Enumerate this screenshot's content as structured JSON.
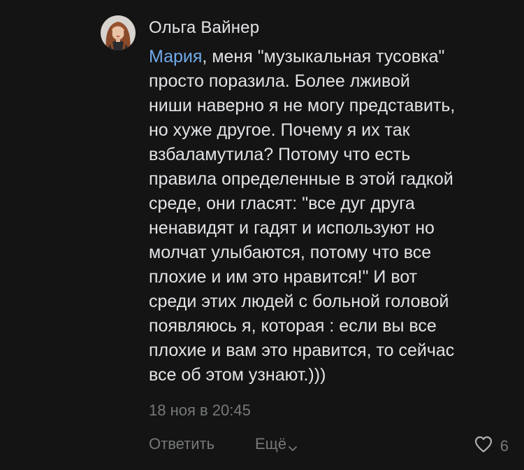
{
  "comment": {
    "author": "Ольга Вайнер",
    "mention": "Мария",
    "text": ", меня \"музыкальная тусовка\"\nпросто поразила. Более лживой\nниши наверно я не могу представить,\nно хуже другое. Почему я их так\nвзбаламутила? Потому что есть\nправила определенные в этой гадкой\nсреде, они гласят: \"все дуг друга\nненавидят и гадят и используют но\nмолчат улыбаются, потому что все\nплохие и им это нравится!\" И вот\nсреди этих людей с больной головой\nпоявляюсь я, которая : если вы все\nплохие и вам это нравится, то сейчас\nвсе об этом узнают.)))",
    "timestamp": "18 ноя в 20:45",
    "reply_label": "Ответить",
    "more_label": "Ещё",
    "likes": "6"
  },
  "icons": {
    "more": "chevron-down-icon",
    "like": "heart-icon"
  },
  "colors": {
    "background": "#141414",
    "text": "#e1e3e6",
    "mention": "#71aaeb",
    "secondary": "#76787a"
  }
}
